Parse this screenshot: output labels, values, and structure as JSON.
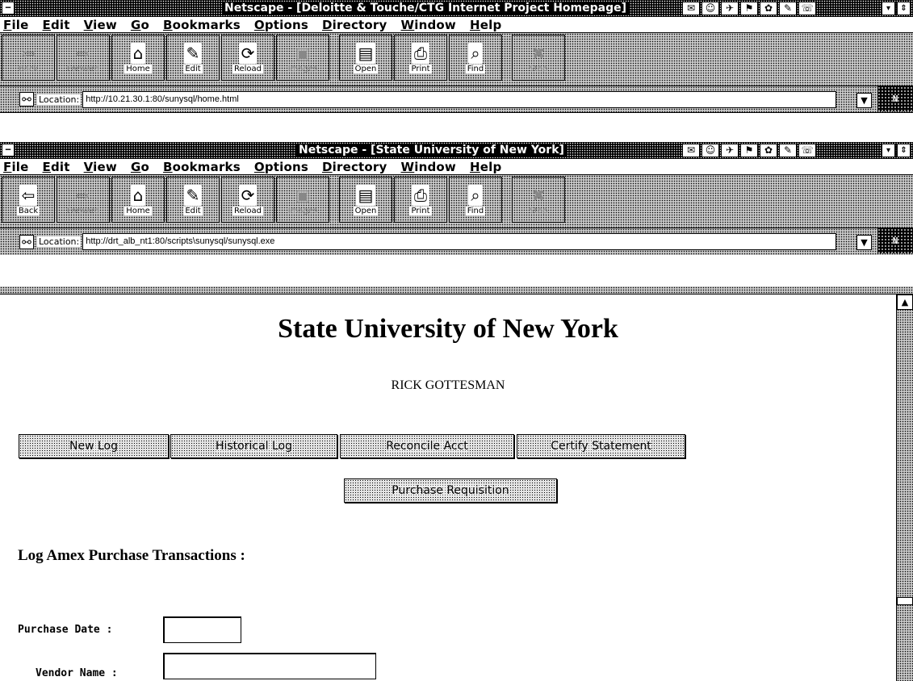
{
  "windows": [
    {
      "title": "Netscape - [Deloitte & Touche/CTG Internet Project Homepage]",
      "menu": [
        "File",
        "Edit",
        "View",
        "Go",
        "Bookmarks",
        "Options",
        "Directory",
        "Window",
        "Help"
      ],
      "toolbar": [
        {
          "label": "Back",
          "icon": "⇦",
          "enabled": false
        },
        {
          "label": "Forward",
          "icon": "⇨",
          "enabled": false
        },
        {
          "label": "Home",
          "icon": "⌂",
          "enabled": true
        },
        {
          "label": "Edit",
          "icon": "✎",
          "enabled": true
        },
        {
          "label": "Reload",
          "icon": "⟳",
          "enabled": true
        },
        {
          "label": "Images",
          "icon": "▣",
          "enabled": false
        },
        {
          "label": "Open",
          "icon": "▤",
          "enabled": true
        },
        {
          "label": "Print",
          "icon": "⎙",
          "enabled": true
        },
        {
          "label": "Find",
          "icon": "⌕",
          "enabled": true
        },
        {
          "label": "Stop",
          "icon": "✖",
          "enabled": false
        }
      ],
      "location_label": "Location:",
      "location_url": "http://10.21.30.1:80/sunysql/home.html"
    },
    {
      "title": "Netscape - [State University of New York]",
      "menu": [
        "File",
        "Edit",
        "View",
        "Go",
        "Bookmarks",
        "Options",
        "Directory",
        "Window",
        "Help"
      ],
      "toolbar": [
        {
          "label": "Back",
          "icon": "⇦",
          "enabled": true
        },
        {
          "label": "Forward",
          "icon": "⇨",
          "enabled": false
        },
        {
          "label": "Home",
          "icon": "⌂",
          "enabled": true
        },
        {
          "label": "Edit",
          "icon": "✎",
          "enabled": true
        },
        {
          "label": "Reload",
          "icon": "⟳",
          "enabled": true
        },
        {
          "label": "Images",
          "icon": "▣",
          "enabled": false
        },
        {
          "label": "Open",
          "icon": "▤",
          "enabled": true
        },
        {
          "label": "Print",
          "icon": "⎙",
          "enabled": true
        },
        {
          "label": "Find",
          "icon": "⌕",
          "enabled": true
        },
        {
          "label": "Stop",
          "icon": "✖",
          "enabled": false
        }
      ],
      "location_label": "Location:",
      "location_url": "http://drt_alb_nt1:80/scripts\\sunysql/sunysql.exe"
    }
  ],
  "page": {
    "title": "State University of New York",
    "user_name": "RICK GOTTESMAN",
    "nav_buttons": [
      "New Log",
      "Historical Log",
      "Reconcile Acct",
      "Certify Statement"
    ],
    "purchase_requisition": "Purchase Requisition",
    "section_heading": "Log Amex Purchase Transactions :",
    "fields": [
      {
        "label": "Purchase Date :",
        "value": ""
      },
      {
        "label": "Vendor Name :",
        "value": ""
      }
    ]
  }
}
